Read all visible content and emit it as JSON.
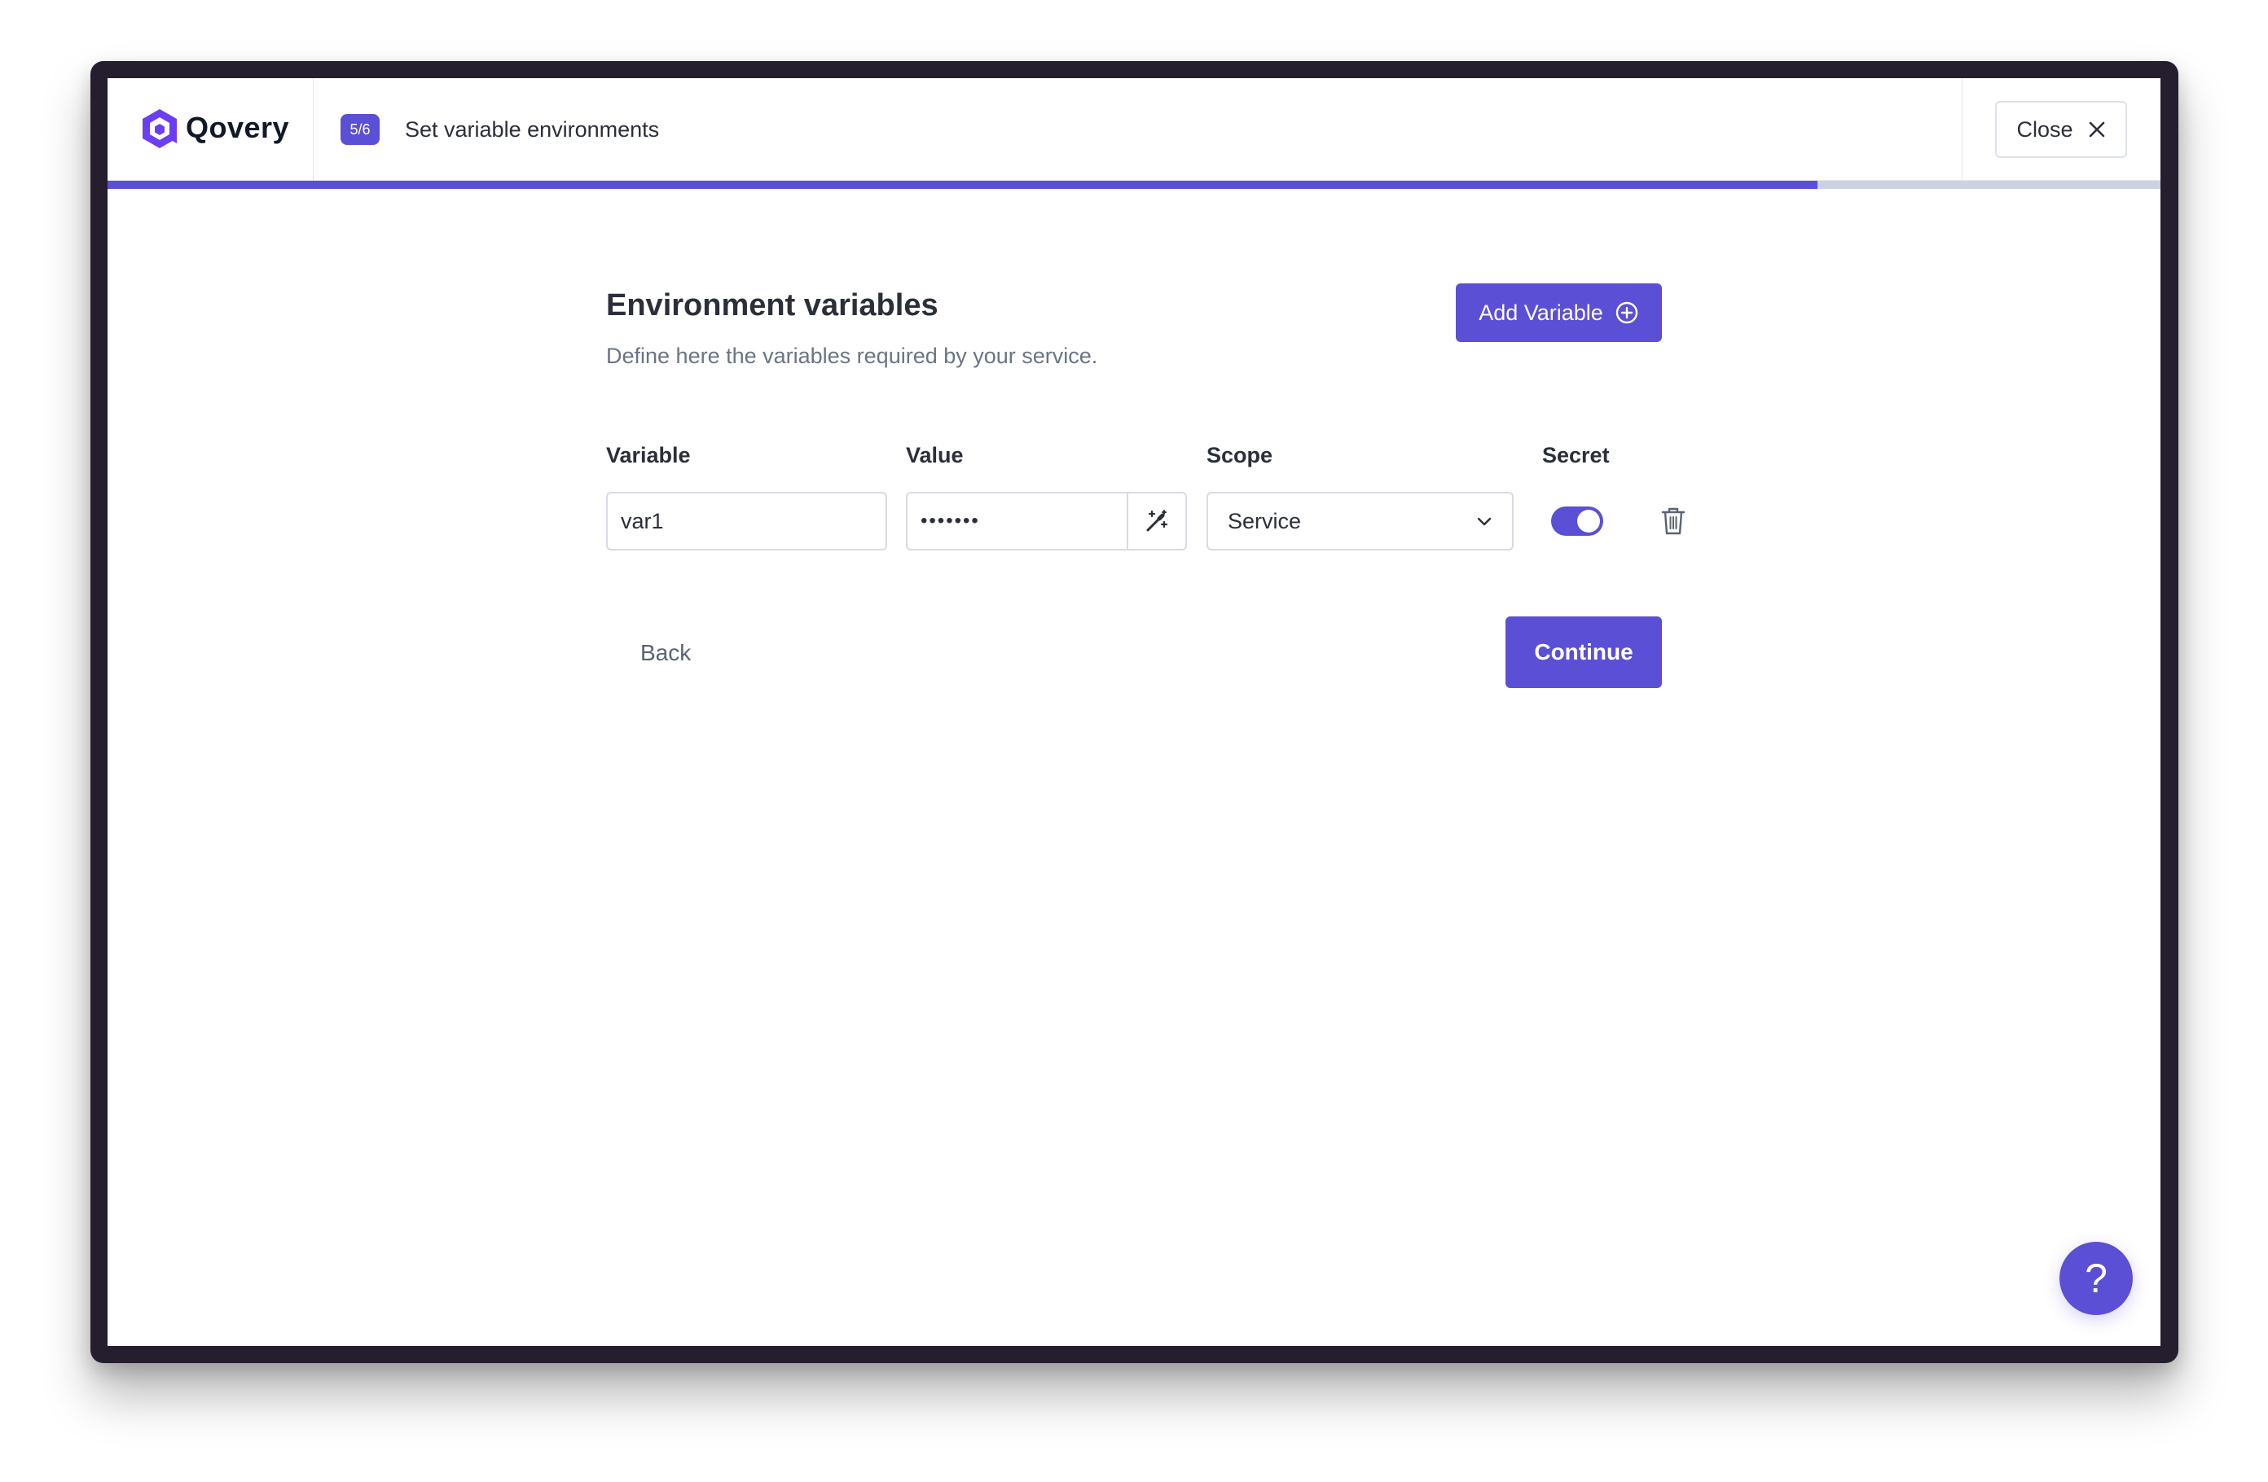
{
  "brand": {
    "name": "Qovery",
    "icon": "qovery-logo-icon"
  },
  "header": {
    "step_badge": "5/6",
    "step_title": "Set variable environments",
    "close_label": "Close",
    "close_icon": "close-icon",
    "progress_fraction": 0.833
  },
  "form": {
    "title": "Environment variables",
    "description": "Define here the variables required by your service.",
    "add_variable_label": "Add Variable",
    "add_variable_icon": "plus-circle-icon",
    "columns": {
      "variable": "Variable",
      "value": "Value",
      "scope": "Scope",
      "secret": "Secret"
    },
    "rows": [
      {
        "variable": "var1",
        "value_masked": "•••••••",
        "scope": "Service",
        "secret": true
      }
    ]
  },
  "footer": {
    "back_label": "Back",
    "continue_label": "Continue"
  },
  "help": {
    "label": "?"
  },
  "colors": {
    "accent": "#5b4fd6",
    "progress_track": "#cdd3de",
    "text": "#2b2f3a",
    "muted": "#6b7385"
  }
}
